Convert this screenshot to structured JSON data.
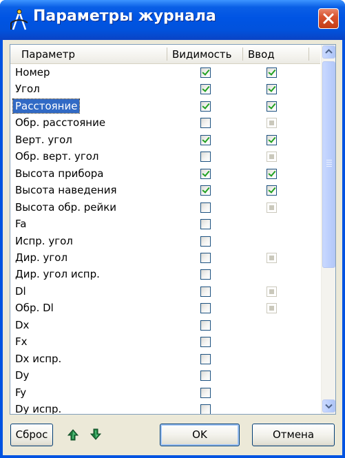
{
  "window": {
    "title": "Параметры журнала",
    "icon": "angle-measure-icon",
    "close_icon": "close-icon"
  },
  "columns": {
    "param": "Параметр",
    "visibility": "Видимость",
    "input": "Ввод"
  },
  "rows": [
    {
      "label": "Номер",
      "visible": true,
      "input": "checked"
    },
    {
      "label": "Угол",
      "visible": true,
      "input": "checked"
    },
    {
      "label": "Расстояние",
      "visible": true,
      "input": "checked",
      "selected": true
    },
    {
      "label": "Обр. расстояние",
      "visible": false,
      "input": "disabled"
    },
    {
      "label": "Верт. угол",
      "visible": true,
      "input": "checked"
    },
    {
      "label": "Обр. верт. угол",
      "visible": false,
      "input": "disabled"
    },
    {
      "label": "Высота прибора",
      "visible": true,
      "input": "checked"
    },
    {
      "label": "Высота наведения",
      "visible": true,
      "input": "checked"
    },
    {
      "label": "Высота обр. рейки",
      "visible": false,
      "input": "disabled"
    },
    {
      "label": "Fa",
      "visible": false,
      "input": "none"
    },
    {
      "label": "Испр. угол",
      "visible": false,
      "input": "none"
    },
    {
      "label": "Дир. угол",
      "visible": false,
      "input": "disabled"
    },
    {
      "label": "Дир. угол испр.",
      "visible": false,
      "input": "none"
    },
    {
      "label": "Dl",
      "visible": false,
      "input": "disabled"
    },
    {
      "label": "Обр. Dl",
      "visible": false,
      "input": "disabled"
    },
    {
      "label": "Dx",
      "visible": false,
      "input": "none"
    },
    {
      "label": "Fx",
      "visible": false,
      "input": "none"
    },
    {
      "label": "Dx испр.",
      "visible": false,
      "input": "none"
    },
    {
      "label": "Dy",
      "visible": false,
      "input": "none"
    },
    {
      "label": "Fy",
      "visible": false,
      "input": "none"
    },
    {
      "label": "Dy испр.",
      "visible": false,
      "input": "none"
    }
  ],
  "footer": {
    "reset_label": "Сброс",
    "move_up_icon": "arrow-up-icon",
    "move_down_icon": "arrow-down-icon",
    "ok_label": "OK",
    "cancel_label": "Отмена"
  },
  "colors": {
    "titlebar": "#0054e3",
    "selection": "#316ac5",
    "check": "#21a121",
    "arrow": "#1f7a3e"
  }
}
